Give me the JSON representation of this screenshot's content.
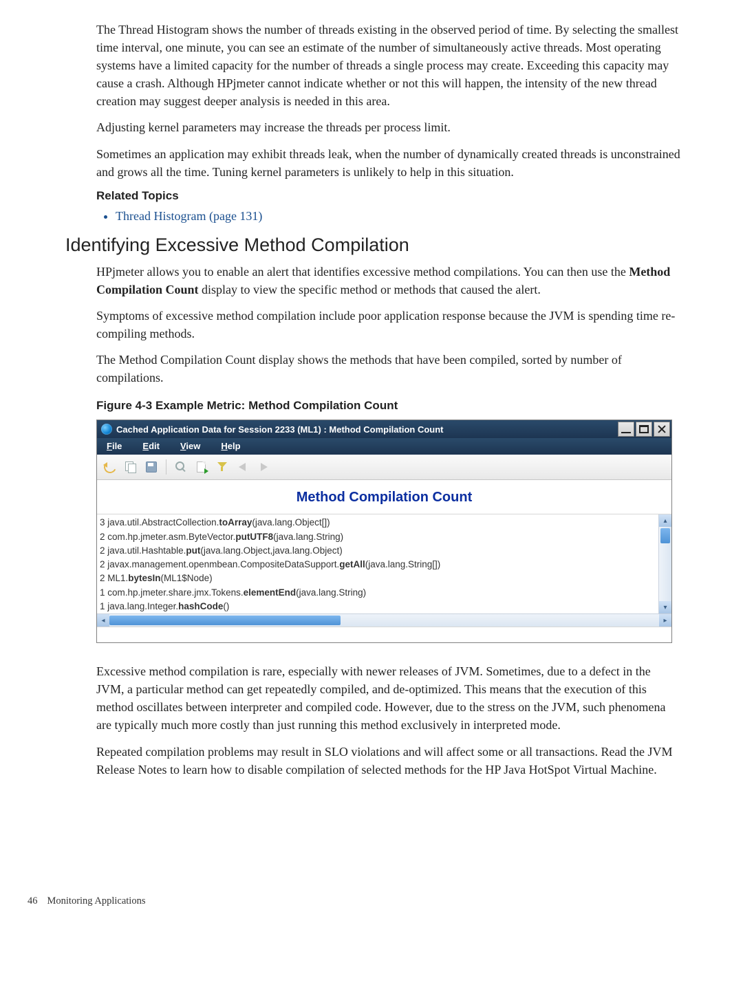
{
  "paragraphs": {
    "p1": "The Thread Histogram shows the number of threads existing in the observed period of time. By selecting the smallest time interval, one minute, you can see an estimate of the number of simultaneously active threads. Most operating systems have a limited capacity for the number of threads a single process may create. Exceeding this capacity may cause a crash. Although HPjmeter cannot indicate whether or not this will happen, the intensity of the new thread creation may suggest deeper analysis is needed in this area.",
    "p2": "Adjusting kernel parameters may increase the threads per process limit.",
    "p3": "Sometimes an application may exhibit threads leak, when the number of dynamically created threads is unconstrained and grows all the time. Tuning kernel parameters is unlikely to help in this situation.",
    "s_p1a": "HPjmeter allows you to enable an alert that identifies excessive method compilations. You can then use the ",
    "s_p1_bold": "Method Compilation Count",
    "s_p1b": " display to view the specific method or methods that caused the alert.",
    "s_p2": "Symptoms of excessive method compilation include poor application response because the JVM is spending time re-compiling methods.",
    "s_p3": "The Method Compilation Count display shows the methods that have been compiled, sorted by number of compilations.",
    "after1": "Excessive method compilation is rare, especially with newer releases of JVM. Sometimes, due to a defect in the JVM, a particular method can get repeatedly compiled, and de-optimized. This means that the execution of this method oscillates between interpreter and compiled code. However, due to the stress on the JVM, such phenomena are typically much more costly than just running this method exclusively in interpreted mode.",
    "after2": "Repeated compilation problems may result in SLO violations and will affect some or all transactions. Read the JVM Release Notes to learn how to disable compilation of selected methods for the HP Java HotSpot Virtual Machine."
  },
  "headings": {
    "related": "Related Topics",
    "section": "Identifying Excessive Method Compilation",
    "figure": "Figure 4-3 Example Metric: Method Compilation Count"
  },
  "related_link": "Thread Histogram (page 131)",
  "window": {
    "title": "Cached Application Data for Session 2233 (ML1) : Method Compilation Count",
    "menus": {
      "file": "File",
      "edit": "Edit",
      "view": "View",
      "help": "Help"
    },
    "panel_title": "Method Compilation Count",
    "rows": [
      {
        "count": "3",
        "pre": " java.util.AbstractCollection.",
        "bold": "toArray",
        "post": "(java.lang.Object[])"
      },
      {
        "count": "2",
        "pre": " com.hp.jmeter.asm.ByteVector.",
        "bold": "putUTF8",
        "post": "(java.lang.String)"
      },
      {
        "count": "2",
        "pre": " java.util.Hashtable.",
        "bold": "put",
        "post": "(java.lang.Object,java.lang.Object)"
      },
      {
        "count": "2",
        "pre": " javax.management.openmbean.CompositeDataSupport.",
        "bold": "getAll",
        "post": "(java.lang.String[])"
      },
      {
        "count": "2",
        "pre": " ML1.",
        "bold": "bytesIn",
        "post": "(ML1$Node)"
      },
      {
        "count": "1",
        "pre": " com.hp.jmeter.share.jmx.Tokens.",
        "bold": "elementEnd",
        "post": "(java.lang.String)"
      },
      {
        "count": "1",
        "pre": " java.lang.Integer.",
        "bold": "hashCode",
        "post": "()"
      }
    ]
  },
  "footer": {
    "page": "46",
    "section": "Monitoring Applications"
  }
}
